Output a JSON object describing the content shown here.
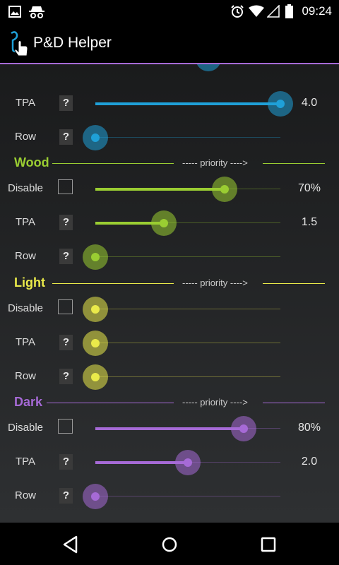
{
  "status_bar": {
    "time": "09:24",
    "icons": [
      "image-icon",
      "incognito-icon",
      "alarm-icon",
      "wifi-icon",
      "signal-icon",
      "battery-icon"
    ]
  },
  "app": {
    "title": "P&D Helper",
    "icon": "touch-hand-icon"
  },
  "colors": {
    "fire": "#1fa0d8",
    "wood": "#9acd32",
    "light": "#eaea4a",
    "dark": "#a66ad6"
  },
  "top_partial": {
    "rows": [
      {
        "label": "TPA",
        "help": "?",
        "value": "4.0",
        "fraction": 1.0
      },
      {
        "label": "Row",
        "help": "?",
        "value": "",
        "fraction": 0.0
      }
    ]
  },
  "sections": [
    {
      "name": "Wood",
      "priority": "----- priority ---->",
      "rows": [
        {
          "label": "Disable",
          "type": "checkbox",
          "checked": false,
          "value": "70%",
          "fraction": 0.7
        },
        {
          "label": "TPA",
          "type": "help",
          "help": "?",
          "value": "1.5",
          "fraction": 0.37
        },
        {
          "label": "Row",
          "type": "help",
          "help": "?",
          "value": "",
          "fraction": 0.0
        }
      ]
    },
    {
      "name": "Light",
      "priority": "----- priority ---->",
      "rows": [
        {
          "label": "Disable",
          "type": "checkbox",
          "checked": false,
          "value": "",
          "fraction": 0.0
        },
        {
          "label": "TPA",
          "type": "help",
          "help": "?",
          "value": "",
          "fraction": 0.0
        },
        {
          "label": "Row",
          "type": "help",
          "help": "?",
          "value": "",
          "fraction": 0.0
        }
      ]
    },
    {
      "name": "Dark",
      "priority": "----- priority ---->",
      "rows": [
        {
          "label": "Disable",
          "type": "checkbox",
          "checked": false,
          "value": "80%",
          "fraction": 0.8
        },
        {
          "label": "TPA",
          "type": "help",
          "help": "?",
          "value": "2.0",
          "fraction": 0.5
        },
        {
          "label": "Row",
          "type": "help",
          "help": "?",
          "value": "",
          "fraction": 0.0
        }
      ]
    }
  ],
  "nav": {
    "back": "back-icon",
    "home": "home-icon",
    "recents": "recents-icon"
  }
}
